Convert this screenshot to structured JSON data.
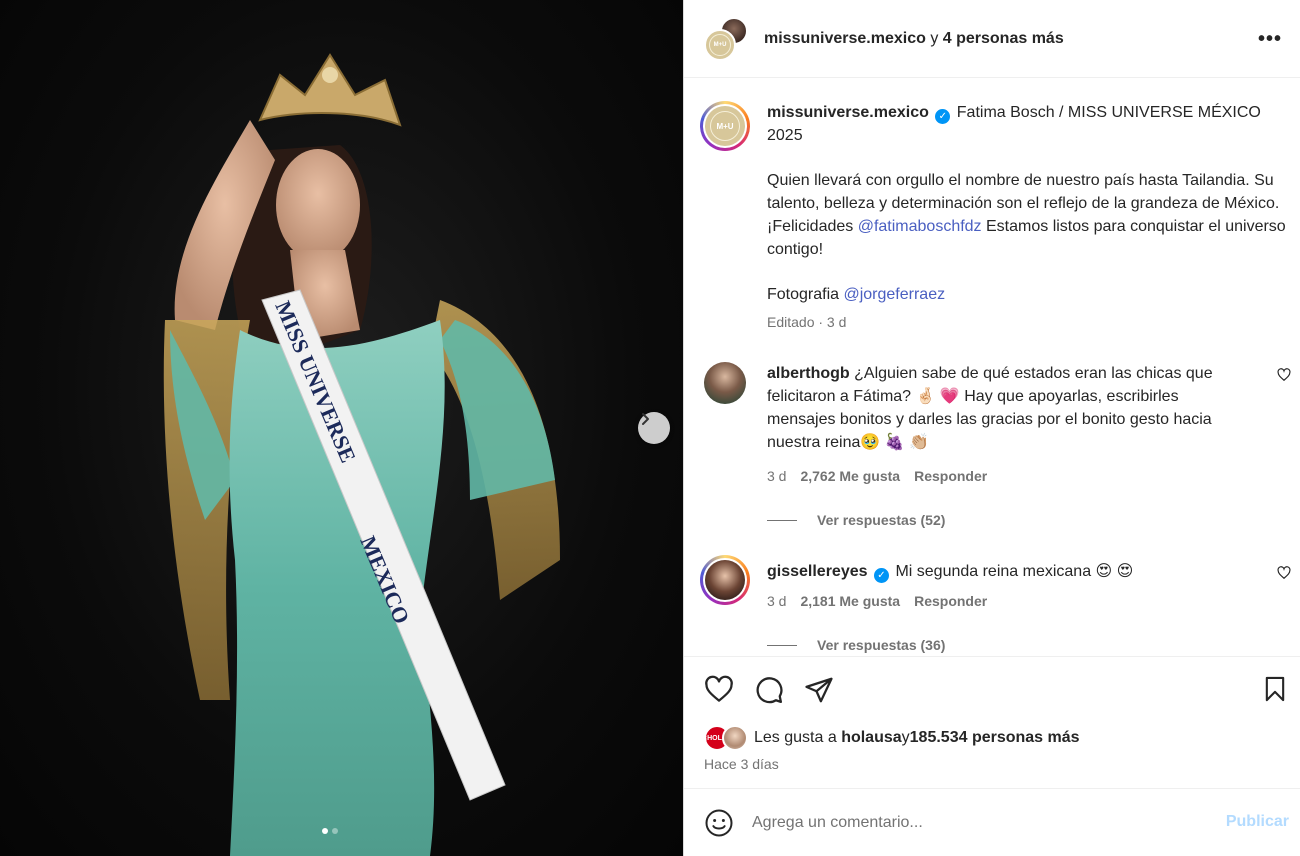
{
  "photo": {
    "sash_line1": "MISS UNIVERSE",
    "sash_line2": "MEXICO",
    "next_icon": "chevron-right-icon",
    "carousel_dots": 2,
    "carousel_active": 1
  },
  "header": {
    "username": "missuniverse.mexico",
    "connector": " y ",
    "others": "4 personas más",
    "more_icon": "more-horizontal-icon",
    "more_label": "•••",
    "avatar_label": "M+U"
  },
  "caption": {
    "username": "missuniverse.mexico",
    "title": "Fatima Bosch / MISS UNIVERSE MÉXICO 2025",
    "paragraph_start": "Quien llevará con orgullo el nombre de nuestro país hasta Tailandia. Su talento, belleza y determinación son el reflejo de la grandeza de México. ¡Felicidades ",
    "mention1": "@fatimaboschfdz",
    "paragraph_end": " Estamos listos para conquistar el universo contigo!",
    "photo_credit": "Fotografia ",
    "mention2": "@jorgeferraez",
    "meta": "Editado · 3 d"
  },
  "comments": [
    {
      "username": "alberthogb",
      "text": "¿Alguien sabe de qué estados eran las chicas que felicitaron a Fátima? 🤞🏻 💗  Hay que apoyarlas, escribirles mensajes bonitos y darles las gracias por el bonito gesto hacia nuestra reina🥹 🍇 👏🏼",
      "time": "3 d",
      "likes": "2,762 Me gusta",
      "reply": "Responder",
      "view_replies": "Ver respuestas (52)"
    },
    {
      "username": "gissellereyes",
      "text": "Mi segunda reina mexicana 😍 😍",
      "time": "3 d",
      "likes": "2,181 Me gusta",
      "reply": "Responder",
      "view_replies": "Ver respuestas (36)"
    }
  ],
  "actions": {
    "like_icon": "heart-icon",
    "comment_icon": "comment-icon",
    "share_icon": "send-icon",
    "save_icon": "bookmark-icon",
    "liked_by_prefix": "Les gusta a ",
    "liked_by_user": "holausa",
    "liked_by_mid": " y ",
    "liked_by_others": "185.534 personas más",
    "hola_badge": "¡HOLA!",
    "posted": "Hace 3 días"
  },
  "add_comment": {
    "emoji_icon": "smiley-icon",
    "placeholder": "Agrega un comentario...",
    "publish": "Publicar"
  },
  "colors": {
    "link": "#4a5fc1",
    "verified": "#0095f6",
    "publish_disabled": "#b3dbff",
    "secondary_text": "#737373"
  }
}
